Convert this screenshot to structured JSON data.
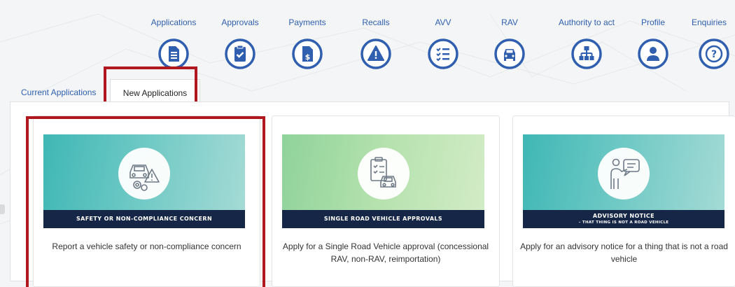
{
  "nav": {
    "items": [
      {
        "label": "Applications",
        "icon": "document-icon"
      },
      {
        "label": "Approvals",
        "icon": "clipboard-check-icon"
      },
      {
        "label": "Payments",
        "icon": "invoice-dollar-icon"
      },
      {
        "label": "Recalls",
        "icon": "warning-triangle-icon"
      },
      {
        "label": "AVV",
        "icon": "checklist-icon"
      },
      {
        "label": "RAV",
        "icon": "car-icon"
      },
      {
        "label": "Authority to act",
        "icon": "org-chart-icon"
      },
      {
        "label": "Profile",
        "icon": "user-icon"
      },
      {
        "label": "Enquiries",
        "icon": "question-icon"
      }
    ],
    "icon_color": "#2f5fae"
  },
  "tabs": {
    "current": "Current Applications",
    "new": "New Applications"
  },
  "cards": [
    {
      "banner_title": "SAFETY OR NON-COMPLIANCE CONCERN",
      "banner_subtitle": "",
      "description": "Report a vehicle safety or non-compliance concern",
      "icon": "car-gears-warning-icon"
    },
    {
      "banner_title": "SINGLE ROAD VEHICLE APPROVALS",
      "banner_subtitle": "",
      "description": "Apply for a Single Road Vehicle approval (concessional RAV, non-RAV, reimportation)",
      "icon": "clipboard-car-icon"
    },
    {
      "banner_title": "ADVISORY NOTICE",
      "banner_subtitle": "– THAT THING IS NOT A ROAD VEHICLE",
      "description": "Apply for an advisory notice for a thing that is not a road vehicle",
      "icon": "presenter-icon"
    }
  ],
  "colors": {
    "highlight": "#b0171f",
    "banner_bar": "#152646",
    "link": "#2f5fae"
  }
}
